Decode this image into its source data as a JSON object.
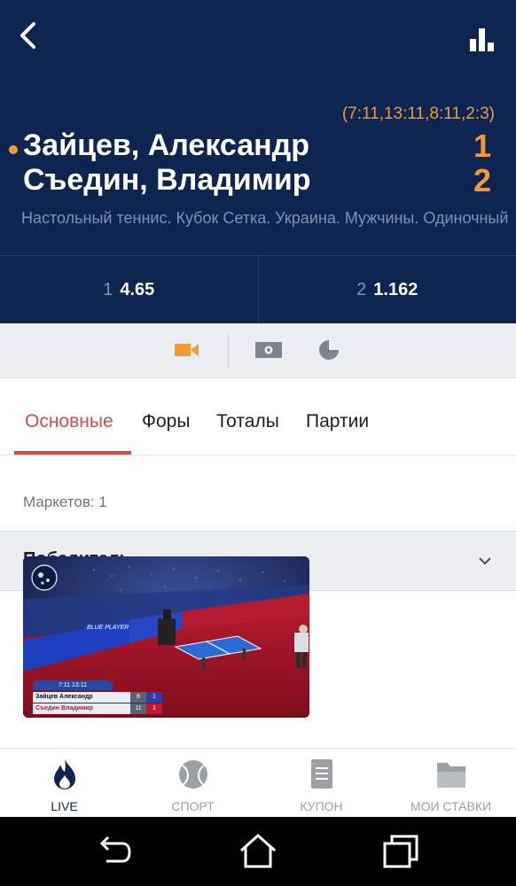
{
  "header": {
    "sets": "(7:11,13:11,8:11,2:3)",
    "player1": "Зайцев, Александр",
    "player2": "Съедин, Владимир",
    "score1": "1",
    "score2": "2",
    "league": "Настольный теннис. Кубок Сетка. Украина. Мужчины. Одиночный"
  },
  "odds": [
    {
      "label": "1",
      "value": "4.65"
    },
    {
      "label": "2",
      "value": "1.162"
    }
  ],
  "media": {
    "video_icon": "video-camera-icon",
    "broadcast_icon": "broadcast-field-icon",
    "stats_icon": "pie-chart-icon"
  },
  "tabs": [
    "Основные",
    "Форы",
    "Тоталы",
    "Партии"
  ],
  "markets_label": "Маркетов: 1",
  "group_title": "Победитель",
  "video_overlay": {
    "sets": "7:11 13:11",
    "rows": [
      {
        "name": "Зайцев Александр",
        "a": "8",
        "b": "1"
      },
      {
        "name": "Съедин Владимир",
        "a": "11",
        "b": "1"
      }
    ],
    "banner": "BLUE PLAYER"
  },
  "bottom_nav": [
    {
      "label": "LIVE",
      "icon": "flame-icon"
    },
    {
      "label": "СПОРТ",
      "icon": "tennis-ball-icon"
    },
    {
      "label": "КУПОН",
      "icon": "coupon-icon"
    },
    {
      "label": "МОИ СТАВКИ",
      "icon": "folder-icon"
    }
  ],
  "colors": {
    "header_bg": "#0d2550",
    "accent": "#f39a32",
    "tab_active": "#d64a4a"
  }
}
